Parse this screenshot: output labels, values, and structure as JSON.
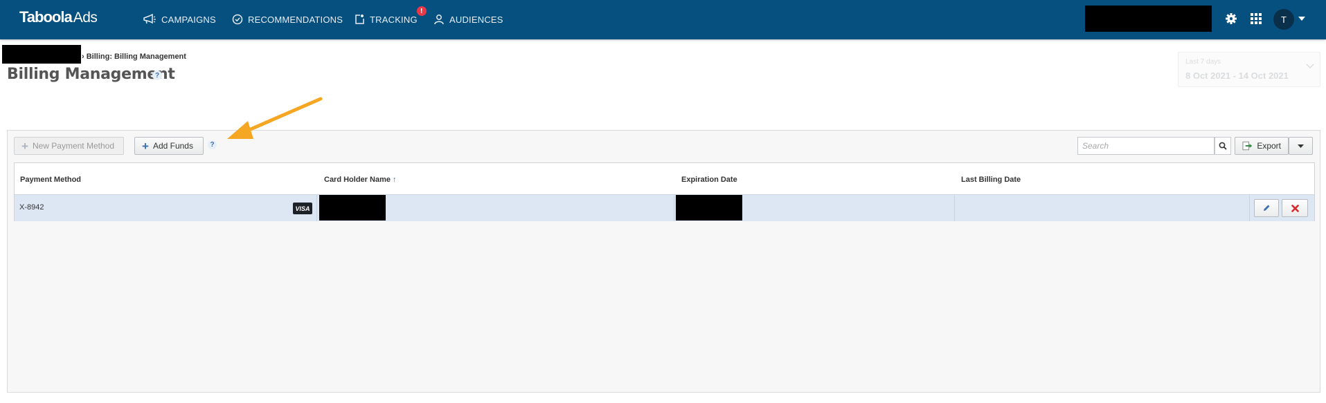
{
  "nav": {
    "brand_bold": "Taboola",
    "brand_light": "Ads",
    "items": [
      {
        "label": "CAMPAIGNS",
        "icon": "megaphone-icon"
      },
      {
        "label": "RECOMMENDATIONS",
        "icon": "check-circle-icon"
      },
      {
        "label": "TRACKING",
        "icon": "tracking-icon",
        "badge": "!"
      },
      {
        "label": "AUDIENCES",
        "icon": "person-icon"
      }
    ],
    "user_initial": "T"
  },
  "header": {
    "breadcrumb": "› Billing: Billing Management",
    "title": "Billing Management",
    "help": "?"
  },
  "date_range": {
    "label": "Last 7 days",
    "value": "8 Oct 2021 - 14 Oct 2021"
  },
  "toolbar": {
    "new_payment_label": "New Payment Method",
    "add_funds_label": "Add Funds",
    "help": "?",
    "search_placeholder": "Search",
    "export_label": "Export"
  },
  "table": {
    "columns": [
      "Payment Method",
      "Card Holder Name",
      "Expiration Date",
      "Last Billing Date"
    ],
    "sort_indicator": "↑",
    "rows": [
      {
        "payment_method": "X-8942",
        "card_brand": "VISA",
        "card_holder": "",
        "expiration": "",
        "last_billing": ""
      }
    ]
  },
  "colors": {
    "nav_bg": "#05507e",
    "row_selected": "#dde7f4",
    "arrow_annotation": "#f5a623",
    "delete_red": "#d9262b",
    "edit_blue": "#3d6fb0"
  }
}
